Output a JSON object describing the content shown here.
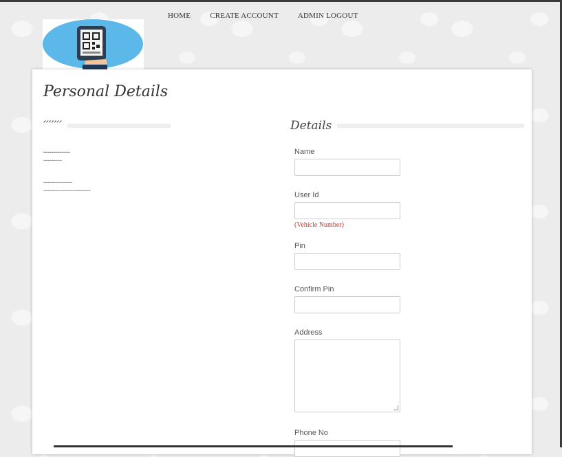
{
  "nav": {
    "items": [
      "HOME",
      "CREATE ACCOUNT",
      "ADMIN LOGOUT"
    ]
  },
  "logo": {
    "icon": "phone-qr-code-icon",
    "bg_color": "#5bb8e8"
  },
  "page": {
    "title": "Personal Details"
  },
  "left_section": {
    "title": "′′′′′′′",
    "lines": [
      "-------------",
      "---------",
      "--------------",
      "-----------------------"
    ]
  },
  "details": {
    "title": "Details",
    "fields": [
      {
        "label": "Name",
        "value": ""
      },
      {
        "label": "User Id",
        "value": "",
        "hint": "(Vehicle Number)"
      },
      {
        "label": "Pin",
        "value": ""
      },
      {
        "label": "Confirm Pin",
        "value": ""
      },
      {
        "label": "Address",
        "value": ""
      },
      {
        "label": "Phone No",
        "value": ""
      }
    ]
  },
  "colors": {
    "hint_red": "#c0392b",
    "panel_bg": "#ffffff"
  }
}
